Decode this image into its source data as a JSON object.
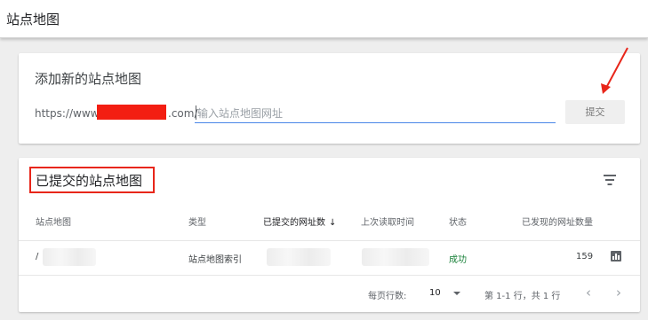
{
  "header": {
    "title": "站点地图"
  },
  "add_sitemap": {
    "heading": "添加新的站点地图",
    "url_prefix": "https://www",
    "url_suffix": ".com/",
    "input_placeholder": "输入站点地图网址",
    "submit_label": "提交"
  },
  "submitted": {
    "heading": "已提交的站点地图",
    "columns": [
      "站点地图",
      "类型",
      "已提交的网址数",
      "上次读取时间",
      "状态",
      "已发现的网址数量"
    ],
    "sorted_column_arrow": "↓",
    "rows": [
      {
        "sitemap": "/",
        "type": "站点地图索引",
        "status": "成功",
        "discovered": "159"
      }
    ],
    "pagination": {
      "rows_per_page_label": "每页行数:",
      "rows_per_page_value": "10",
      "range_text": "第 1-1 行，共 1 行",
      "prev_icon": "‹",
      "next_icon": "›"
    }
  },
  "colors": {
    "redaction": "#f31e12",
    "annotation": "#e8261a",
    "input_underline": "#4a86e8",
    "success": "#188038"
  }
}
